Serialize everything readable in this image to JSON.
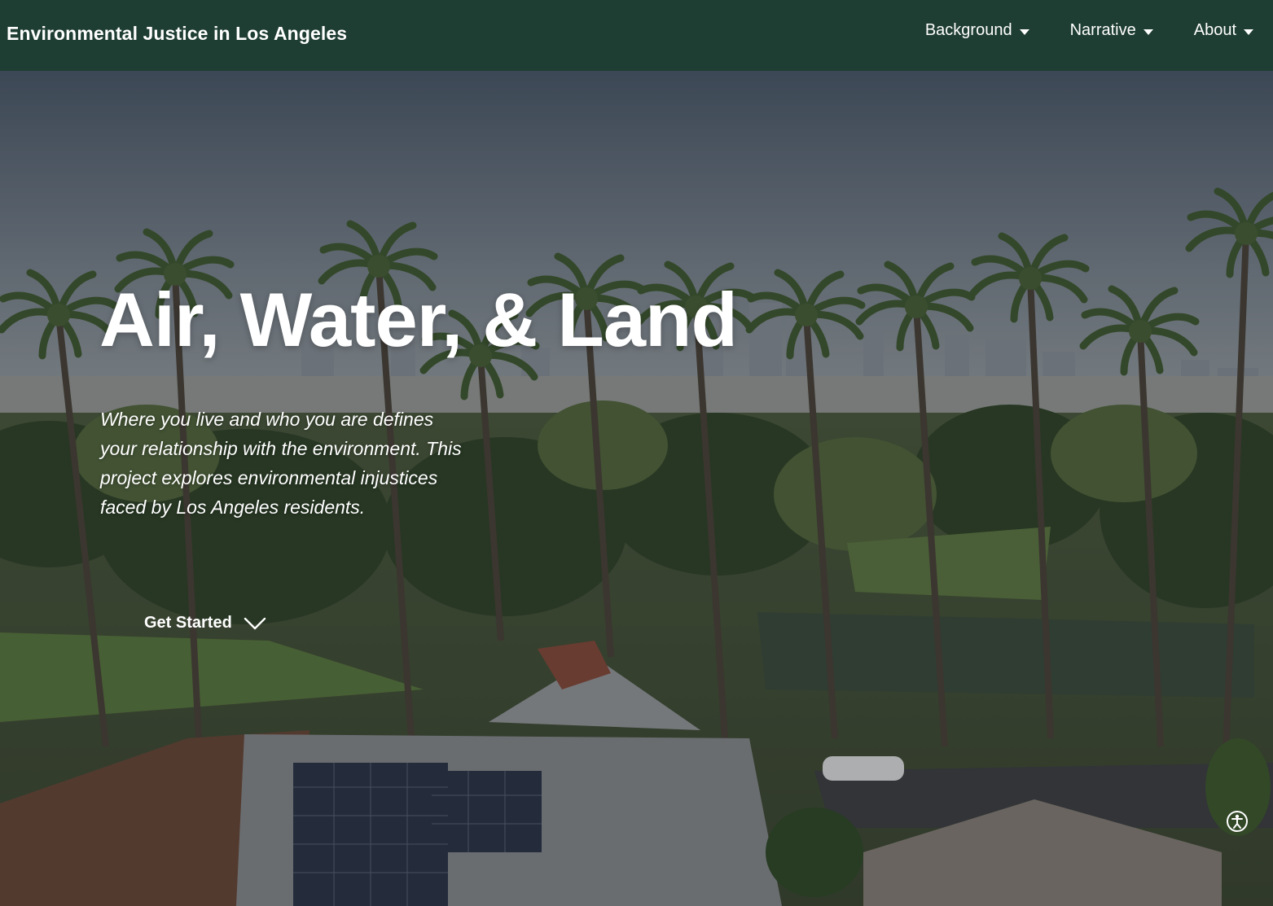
{
  "header": {
    "brand": "Environmental Justice in Los Angeles",
    "nav": [
      {
        "label": "Background"
      },
      {
        "label": "Narrative"
      },
      {
        "label": "About"
      }
    ]
  },
  "hero": {
    "title": "Air, Water, & Land",
    "description": "Where you live and who you are defines your relationship with the environment. This project explores environmental injustices faced by Los Angeles residents.",
    "cta_label": "Get Started",
    "cta_icon": "chevron-down-icon",
    "background": "aerial-photo-palm-trees-los-angeles-skyline"
  },
  "widgets": {
    "accessibility_icon": "accessibility-icon"
  },
  "colors": {
    "navbar": "#1e3d33",
    "text": "#ffffff"
  }
}
